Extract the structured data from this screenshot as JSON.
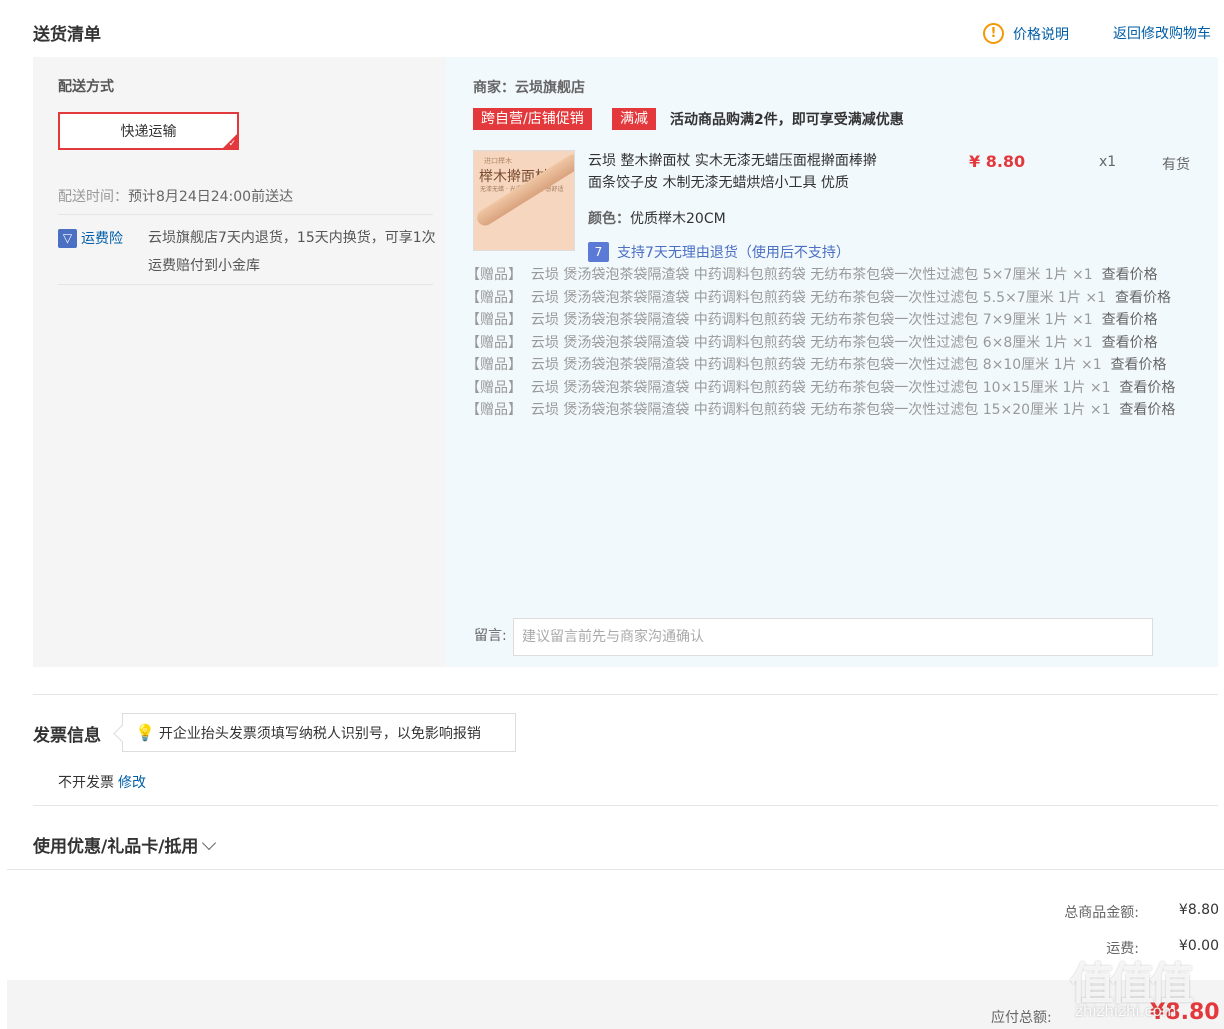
{
  "header": {
    "title": "送货清单",
    "price_note": "价格说明",
    "back_to_cart": "返回修改购物车"
  },
  "shipping": {
    "label": "配送方式",
    "method": "快递运输",
    "time_label": "配送时间：",
    "time_value": "预计8月24日24:00前送达",
    "insurance_label": "运费险",
    "insurance_text": "云埙旗舰店7天内退货，15天内换货，可享1次运费赔付到小金库"
  },
  "order": {
    "merchant": "商家：云埙旗舰店",
    "tags": [
      "跨自营/店铺促销",
      "满减"
    ],
    "promo_text": "活动商品购满2件，即可享受满减优惠",
    "product": {
      "thumb_brand": "进口榉木",
      "thumb_name": "榉木擀面杖",
      "thumb_sub": "无漆无蜡 · 光滑圆润 · 手感舒适",
      "name": "云埙 整木擀面杖 实木无漆无蜡压面棍擀面棒擀面条饺子皮 木制无漆无蜡烘焙小工具 优质",
      "price": "¥ 8.80",
      "qty": "x1",
      "stock": "有货",
      "color_label": "颜色：",
      "color_value": "优质榉木20CM",
      "return_icon": "7",
      "return_text": "支持7天无理由退货（使用后不支持）"
    },
    "gift_prefix": "【赠品】",
    "gift_link": "查看价格",
    "gifts": [
      "云埙 煲汤袋泡茶袋隔渣袋 中药调料包煎药袋 无纺布茶包袋一次性过滤包 5×7厘米 1片 ×1",
      "云埙 煲汤袋泡茶袋隔渣袋 中药调料包煎药袋 无纺布茶包袋一次性过滤包 5.5×7厘米 1片 ×1",
      "云埙 煲汤袋泡茶袋隔渣袋 中药调料包煎药袋 无纺布茶包袋一次性过滤包 7×9厘米 1片 ×1",
      "云埙 煲汤袋泡茶袋隔渣袋 中药调料包煎药袋 无纺布茶包袋一次性过滤包 6×8厘米 1片 ×1",
      "云埙 煲汤袋泡茶袋隔渣袋 中药调料包煎药袋 无纺布茶包袋一次性过滤包 8×10厘米 1片 ×1",
      "云埙 煲汤袋泡茶袋隔渣袋 中药调料包煎药袋 无纺布茶包袋一次性过滤包 10×15厘米 1片 ×1",
      "云埙 煲汤袋泡茶袋隔渣袋 中药调料包煎药袋 无纺布茶包袋一次性过滤包 15×20厘米 1片 ×1"
    ],
    "message_label": "留言:",
    "message_placeholder": "建议留言前先与商家沟通确认"
  },
  "invoice": {
    "title": "发票信息",
    "tip": "开企业抬头发票须填写纳税人识别号，以免影响报销",
    "status": "不开发票",
    "edit": "修改"
  },
  "coupon": {
    "title": "使用优惠/礼品卡/抵用"
  },
  "summary": {
    "goods_label": "总商品金额:",
    "goods_value": "¥8.80",
    "freight_label": "运费:",
    "freight_value": "¥0.00",
    "payable_label": "应付总额:",
    "payable_value": "¥8.80"
  },
  "watermark": {
    "logo": "值值值",
    "url": "zhizhizhi.com"
  },
  "colors": {
    "accent_red": "#e4393c",
    "link_blue": "#005ea7",
    "panel_gray": "#f5f5f5",
    "panel_blue": "#f2f9fd"
  }
}
